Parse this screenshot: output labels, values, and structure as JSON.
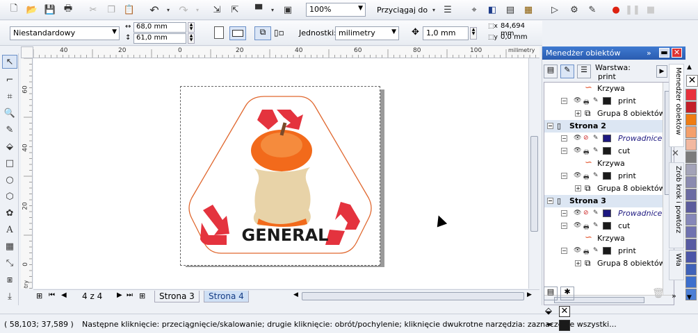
{
  "toolbar": {
    "zoom": "100%",
    "snap_label": "Przyciągaj do"
  },
  "property_bar": {
    "paper_type": "Niestandardowy",
    "width": "68,0 mm",
    "height": "61,0 mm",
    "units_label": "Jednostki:",
    "units_value": "milimetry",
    "nudge": "1,0 mm",
    "dup_x": "84,694 mm",
    "dup_y": "0,0 mm"
  },
  "ruler": {
    "h_labels": [
      "40",
      "20",
      "0",
      "20",
      "40",
      "60",
      "80",
      "100"
    ],
    "h_unit": "milimetry",
    "v_labels": [
      "60",
      "40",
      "20",
      "0"
    ],
    "v_unit": "milimetry"
  },
  "artwork": {
    "text": "GENERAL",
    "colors": {
      "arrow": "#e4333e",
      "outline": "#e0672e",
      "apple": "#f26a1b"
    }
  },
  "page_nav": {
    "counter": "4 z 4",
    "tabs": [
      "Strona 3",
      "Strona 4"
    ]
  },
  "object_manager": {
    "title": "Menedżer obiektów",
    "layer_label": "Warstwa:",
    "layer_value": "print",
    "rows": [
      {
        "type": "obj",
        "label": "Krzywa"
      },
      {
        "type": "layer",
        "label": "print",
        "color": "#1a1a1a"
      },
      {
        "type": "group",
        "label": "Grupa 8 obiektów"
      },
      {
        "type": "page",
        "label": "Strona 2"
      },
      {
        "type": "layer",
        "label": "Prowadnice",
        "color": "#1d1880",
        "italic": true
      },
      {
        "type": "layer",
        "label": "cut",
        "color": "#1a1a1a"
      },
      {
        "type": "obj",
        "label": "Krzywa"
      },
      {
        "type": "layer",
        "label": "print",
        "color": "#1a1a1a"
      },
      {
        "type": "group",
        "label": "Grupa 8 obiektów"
      },
      {
        "type": "page",
        "label": "Strona 3"
      },
      {
        "type": "layer",
        "label": "Prowadnice",
        "color": "#1d1880",
        "italic": true
      },
      {
        "type": "layer",
        "label": "cut",
        "color": "#1a1a1a"
      },
      {
        "type": "obj",
        "label": "Krzywa"
      },
      {
        "type": "layer",
        "label": "print",
        "color": "#1a1a1a"
      },
      {
        "type": "group",
        "label": "Grupa 8 obiektów"
      }
    ]
  },
  "side_tabs": [
    "Menedżer obiektów",
    "Zrób krok i powtórz",
    "Wła"
  ],
  "palette": [
    "#ffffff",
    "#e8303c",
    "#c41f29",
    "#ef7c12",
    "#f4a06c",
    "#f2b8a0",
    "#7b7b7b",
    "#a3a3b8",
    "#8a8ab0",
    "#6b6ba3",
    "#5b5b9c",
    "#8587b9",
    "#6f72b0",
    "#575aa2",
    "#4b55a8",
    "#3f62b9",
    "#3c6fcd",
    "#4d7fd6"
  ],
  "status": {
    "coords": "( 58,103; 37,589 )",
    "message": "Następne kliknięcie: przeciągnięcie/skalowanie; drugie kliknięcie: obrót/pochylenie; kliknięcie dwukrotne narzędzia: zaznaczenie wszystki..."
  }
}
